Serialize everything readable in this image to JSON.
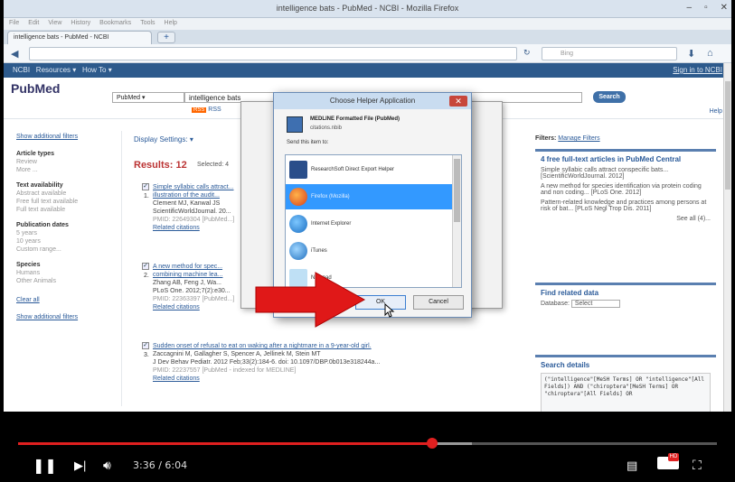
{
  "browser": {
    "window_title": "intelligence bats - PubMed - NCBI - Mozilla Firefox",
    "tab_title": "intelligence bats - PubMed - NCBI",
    "new_tab": "+",
    "menu": [
      "File",
      "Edit",
      "View",
      "History",
      "Bookmarks",
      "Tools",
      "Help"
    ],
    "search_placeholder": "Bing"
  },
  "ncbi": {
    "brand": "NCBI",
    "resources": "Resources",
    "howto": "How To",
    "signin": "Sign in to NCBI"
  },
  "pubmed": {
    "logo": "PubMed",
    "db": "PubMed",
    "query": "intelligence bats",
    "search_btn": "Search",
    "rss": "RSS",
    "help": "Help",
    "display_settings": "Display Settings:",
    "results_label": "Results: 12",
    "selected_label": "Selected: 4"
  },
  "sidebar": {
    "show_filters": "Show additional filters",
    "groups": [
      {
        "title": "Article types",
        "items": [
          "Review",
          "More ..."
        ]
      },
      {
        "title": "Text availability",
        "items": [
          "Abstract available",
          "Free full text available",
          "Full text available"
        ]
      },
      {
        "title": "Publication dates",
        "items": [
          "5 years",
          "10 years",
          "Custom range..."
        ]
      },
      {
        "title": "Species",
        "items": [
          "Humans",
          "Other Animals"
        ]
      }
    ],
    "clear_all": "Clear all",
    "show_filters_bottom": "Show additional filters"
  },
  "results": [
    {
      "num": "1.",
      "title": "Simple syllabic calls attract...",
      "line2": "illustration of the audit...",
      "authors": "Clement MJ, Kanwal JS",
      "journal": "ScientificWorldJournal. 20...",
      "pmid": "PMID: 22649304 [PubMed...]",
      "related": "Related citations"
    },
    {
      "num": "2.",
      "title": "A new method for spec...",
      "line2": "combining machine lea...",
      "authors": "Zhang AB, Feng J, Wa...",
      "journal": "PLoS One. 2012;7(2):e30...",
      "pmid": "PMID: 22363397 [PubMed...]",
      "related": "Related citations"
    },
    {
      "num": "3.",
      "title": "Sudden onset of refusal to eat on waking after a nightmare in a 9-year-old girl.",
      "line2": "",
      "authors": "Zaccagnini M, Gallagher S, Spencer A, Jellinek M, Stein MT",
      "journal": "J Dev Behav Pediatr. 2012 Feb;33(2):184-6. doi: 10.1097/DBP.0b013e318244a...",
      "pmid": "PMID: 22237557 [PubMed - indexed for MEDLINE]",
      "related": "Related citations"
    }
  ],
  "right": {
    "filter_label": "Filters:",
    "manage_filters": "Manage Filters",
    "free_fulltext_title": "4 free full-text articles in PubMed Central",
    "free_items": [
      "Simple syllabic calls attract conspecific bats... [ScientificWorldJournal. 2012]",
      "A new method for species identification via protein coding and non coding... [PLoS One. 2012]",
      "Pattern-related knowledge and practices among persons at risk of bat... [PLoS Negl Trop Dis. 2011]"
    ],
    "see_all": "See all (4)...",
    "find_related": "Find related data",
    "database_label": "Database:",
    "database_select": "Select",
    "search_details": "Search details",
    "search_details_text": "(\"intelligence\"[MeSH Terms] OR \"intelligence\"[All Fields]) AND (\"chiroptera\"[MeSH Terms] OR \"chiroptera\"[All Fields] OR"
  },
  "dialog": {
    "title": "Choose Helper Application",
    "file_type": "MEDLINE Formatted File (PubMed)",
    "file_name": "citations.nbib",
    "send_label": "Send this item to:",
    "apps": [
      "ResearchSoft Direct Export Helper",
      "Firefox (Mozilla)",
      "Internet Explorer",
      "iTunes",
      "Notepad"
    ],
    "selected_index": 1,
    "ok": "OK",
    "cancel": "Cancel"
  },
  "player": {
    "time": "3:36 / 6:04",
    "progress": 0.593,
    "buffered": 0.65
  }
}
